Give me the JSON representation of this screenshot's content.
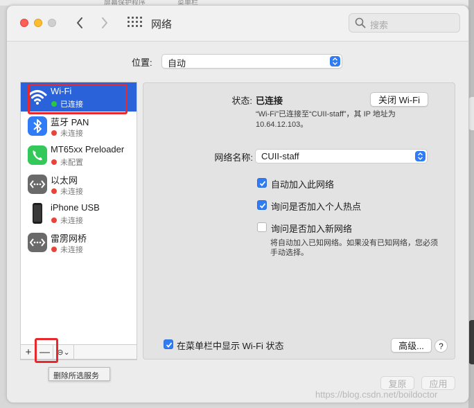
{
  "background": {
    "menu_fragments": [
      "屏幕保护程序",
      "菜单栏"
    ]
  },
  "window": {
    "title": "网络",
    "search_placeholder": "搜索"
  },
  "location": {
    "label": "位置:",
    "value": "自动"
  },
  "services": [
    {
      "name": "Wi-Fi",
      "status": "已连接",
      "status_color": "green",
      "icon": "wifi-icon",
      "selected": true
    },
    {
      "name": "蓝牙 PAN",
      "status": "未连接",
      "status_color": "red",
      "icon": "bluetooth-icon",
      "selected": false
    },
    {
      "name": "MT65xx Preloader",
      "status": "未配置",
      "status_color": "red",
      "icon": "phone-call-icon",
      "selected": false
    },
    {
      "name": "以太网",
      "status": "未连接",
      "status_color": "red",
      "icon": "ethernet-icon",
      "selected": false
    },
    {
      "name": "iPhone USB",
      "status": "未连接",
      "status_color": "red",
      "icon": "iphone-icon",
      "selected": false
    },
    {
      "name": "雷雳网桥",
      "status": "未连接",
      "status_color": "red",
      "icon": "thunderbolt-bridge-icon",
      "selected": false
    }
  ],
  "sidebar_actions": {
    "add": "+",
    "remove": "—",
    "more": "⊖⌄"
  },
  "tooltip": "删除所选服务",
  "detail": {
    "status_label": "状态:",
    "status_value": "已连接",
    "toggle_wifi": "关闭 Wi-Fi",
    "status_desc_1": "“Wi-Fi”已连接至“CUII-staff”，其 IP 地址为",
    "status_desc_2": "10.64.12.103。",
    "network_name_label": "网络名称:",
    "network_name_value": "CUII-staff",
    "options": [
      {
        "label": "自动加入此网络",
        "checked": true
      },
      {
        "label": "询问是否加入个人热点",
        "checked": true
      },
      {
        "label": "询问是否加入新网络",
        "checked": false
      }
    ],
    "ask_desc_1": "将自动加入已知网络。如果没有已知网络，您必须",
    "ask_desc_2": "手动选择。",
    "show_in_menubar": "在菜单栏中显示 Wi-Fi 状态",
    "show_in_menubar_checked": true,
    "advanced": "高级...",
    "help": "?"
  },
  "footer": {
    "revert": "复原",
    "apply": "应用"
  },
  "watermark": "https://blog.csdn.net/boildoctor",
  "colors": {
    "accent": "#2f7cf6",
    "selection": "#2a62d9",
    "highlight": "#e8282c",
    "connected": "#28c840",
    "disconnected": "#e8443a"
  }
}
